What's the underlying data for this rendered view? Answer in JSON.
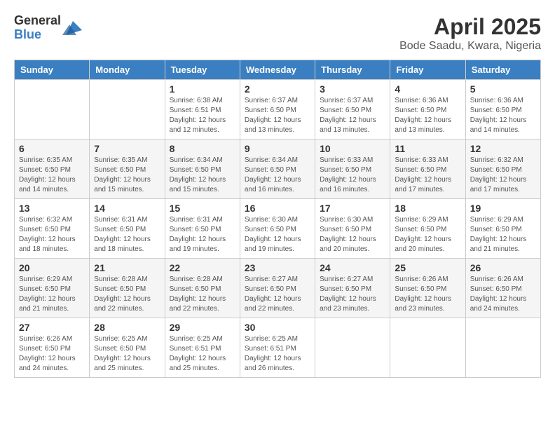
{
  "header": {
    "logo_general": "General",
    "logo_blue": "Blue",
    "month_year": "April 2025",
    "location": "Bode Saadu, Kwara, Nigeria"
  },
  "days_of_week": [
    "Sunday",
    "Monday",
    "Tuesday",
    "Wednesday",
    "Thursday",
    "Friday",
    "Saturday"
  ],
  "weeks": [
    [
      {
        "day": "",
        "sunrise": "",
        "sunset": "",
        "daylight": ""
      },
      {
        "day": "",
        "sunrise": "",
        "sunset": "",
        "daylight": ""
      },
      {
        "day": "1",
        "sunrise": "Sunrise: 6:38 AM",
        "sunset": "Sunset: 6:51 PM",
        "daylight": "Daylight: 12 hours and 12 minutes."
      },
      {
        "day": "2",
        "sunrise": "Sunrise: 6:37 AM",
        "sunset": "Sunset: 6:50 PM",
        "daylight": "Daylight: 12 hours and 13 minutes."
      },
      {
        "day": "3",
        "sunrise": "Sunrise: 6:37 AM",
        "sunset": "Sunset: 6:50 PM",
        "daylight": "Daylight: 12 hours and 13 minutes."
      },
      {
        "day": "4",
        "sunrise": "Sunrise: 6:36 AM",
        "sunset": "Sunset: 6:50 PM",
        "daylight": "Daylight: 12 hours and 13 minutes."
      },
      {
        "day": "5",
        "sunrise": "Sunrise: 6:36 AM",
        "sunset": "Sunset: 6:50 PM",
        "daylight": "Daylight: 12 hours and 14 minutes."
      }
    ],
    [
      {
        "day": "6",
        "sunrise": "Sunrise: 6:35 AM",
        "sunset": "Sunset: 6:50 PM",
        "daylight": "Daylight: 12 hours and 14 minutes."
      },
      {
        "day": "7",
        "sunrise": "Sunrise: 6:35 AM",
        "sunset": "Sunset: 6:50 PM",
        "daylight": "Daylight: 12 hours and 15 minutes."
      },
      {
        "day": "8",
        "sunrise": "Sunrise: 6:34 AM",
        "sunset": "Sunset: 6:50 PM",
        "daylight": "Daylight: 12 hours and 15 minutes."
      },
      {
        "day": "9",
        "sunrise": "Sunrise: 6:34 AM",
        "sunset": "Sunset: 6:50 PM",
        "daylight": "Daylight: 12 hours and 16 minutes."
      },
      {
        "day": "10",
        "sunrise": "Sunrise: 6:33 AM",
        "sunset": "Sunset: 6:50 PM",
        "daylight": "Daylight: 12 hours and 16 minutes."
      },
      {
        "day": "11",
        "sunrise": "Sunrise: 6:33 AM",
        "sunset": "Sunset: 6:50 PM",
        "daylight": "Daylight: 12 hours and 17 minutes."
      },
      {
        "day": "12",
        "sunrise": "Sunrise: 6:32 AM",
        "sunset": "Sunset: 6:50 PM",
        "daylight": "Daylight: 12 hours and 17 minutes."
      }
    ],
    [
      {
        "day": "13",
        "sunrise": "Sunrise: 6:32 AM",
        "sunset": "Sunset: 6:50 PM",
        "daylight": "Daylight: 12 hours and 18 minutes."
      },
      {
        "day": "14",
        "sunrise": "Sunrise: 6:31 AM",
        "sunset": "Sunset: 6:50 PM",
        "daylight": "Daylight: 12 hours and 18 minutes."
      },
      {
        "day": "15",
        "sunrise": "Sunrise: 6:31 AM",
        "sunset": "Sunset: 6:50 PM",
        "daylight": "Daylight: 12 hours and 19 minutes."
      },
      {
        "day": "16",
        "sunrise": "Sunrise: 6:30 AM",
        "sunset": "Sunset: 6:50 PM",
        "daylight": "Daylight: 12 hours and 19 minutes."
      },
      {
        "day": "17",
        "sunrise": "Sunrise: 6:30 AM",
        "sunset": "Sunset: 6:50 PM",
        "daylight": "Daylight: 12 hours and 20 minutes."
      },
      {
        "day": "18",
        "sunrise": "Sunrise: 6:29 AM",
        "sunset": "Sunset: 6:50 PM",
        "daylight": "Daylight: 12 hours and 20 minutes."
      },
      {
        "day": "19",
        "sunrise": "Sunrise: 6:29 AM",
        "sunset": "Sunset: 6:50 PM",
        "daylight": "Daylight: 12 hours and 21 minutes."
      }
    ],
    [
      {
        "day": "20",
        "sunrise": "Sunrise: 6:29 AM",
        "sunset": "Sunset: 6:50 PM",
        "daylight": "Daylight: 12 hours and 21 minutes."
      },
      {
        "day": "21",
        "sunrise": "Sunrise: 6:28 AM",
        "sunset": "Sunset: 6:50 PM",
        "daylight": "Daylight: 12 hours and 22 minutes."
      },
      {
        "day": "22",
        "sunrise": "Sunrise: 6:28 AM",
        "sunset": "Sunset: 6:50 PM",
        "daylight": "Daylight: 12 hours and 22 minutes."
      },
      {
        "day": "23",
        "sunrise": "Sunrise: 6:27 AM",
        "sunset": "Sunset: 6:50 PM",
        "daylight": "Daylight: 12 hours and 22 minutes."
      },
      {
        "day": "24",
        "sunrise": "Sunrise: 6:27 AM",
        "sunset": "Sunset: 6:50 PM",
        "daylight": "Daylight: 12 hours and 23 minutes."
      },
      {
        "day": "25",
        "sunrise": "Sunrise: 6:26 AM",
        "sunset": "Sunset: 6:50 PM",
        "daylight": "Daylight: 12 hours and 23 minutes."
      },
      {
        "day": "26",
        "sunrise": "Sunrise: 6:26 AM",
        "sunset": "Sunset: 6:50 PM",
        "daylight": "Daylight: 12 hours and 24 minutes."
      }
    ],
    [
      {
        "day": "27",
        "sunrise": "Sunrise: 6:26 AM",
        "sunset": "Sunset: 6:50 PM",
        "daylight": "Daylight: 12 hours and 24 minutes."
      },
      {
        "day": "28",
        "sunrise": "Sunrise: 6:25 AM",
        "sunset": "Sunset: 6:50 PM",
        "daylight": "Daylight: 12 hours and 25 minutes."
      },
      {
        "day": "29",
        "sunrise": "Sunrise: 6:25 AM",
        "sunset": "Sunset: 6:51 PM",
        "daylight": "Daylight: 12 hours and 25 minutes."
      },
      {
        "day": "30",
        "sunrise": "Sunrise: 6:25 AM",
        "sunset": "Sunset: 6:51 PM",
        "daylight": "Daylight: 12 hours and 26 minutes."
      },
      {
        "day": "",
        "sunrise": "",
        "sunset": "",
        "daylight": ""
      },
      {
        "day": "",
        "sunrise": "",
        "sunset": "",
        "daylight": ""
      },
      {
        "day": "",
        "sunrise": "",
        "sunset": "",
        "daylight": ""
      }
    ]
  ]
}
